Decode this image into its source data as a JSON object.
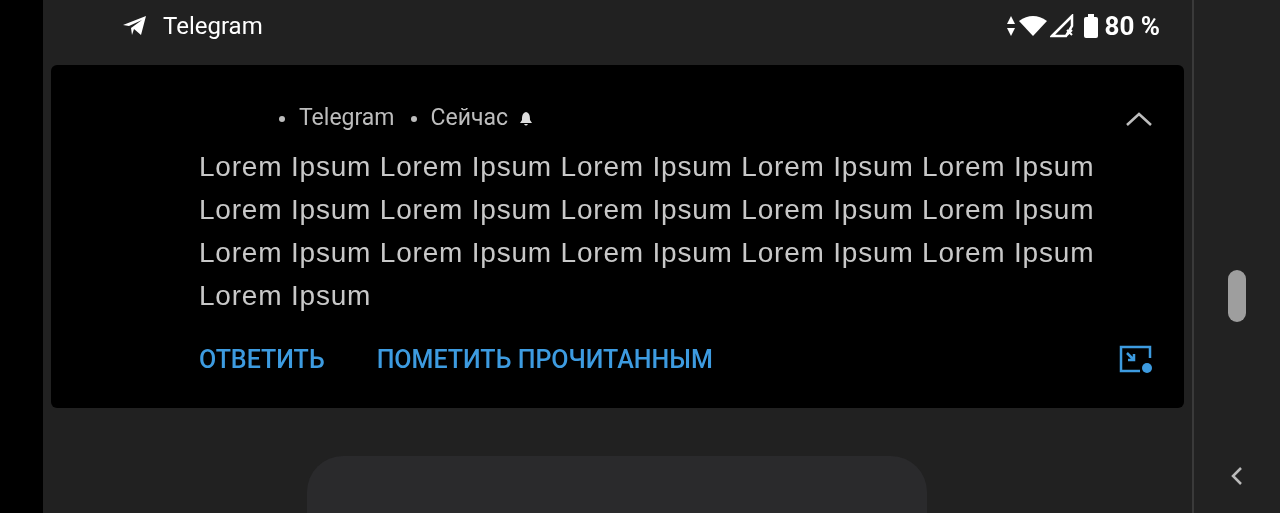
{
  "status_bar": {
    "app_name": "Telegram",
    "battery": "80 %"
  },
  "notification": {
    "app": "Telegram",
    "time": "Сейчас",
    "expanded": true,
    "message": "Lorem Ipsum Lorem Ipsum Lorem Ipsum Lorem Ipsum Lorem Ipsum Lorem Ipsum Lorem Ipsum Lorem Ipsum Lorem Ipsum Lorem Ipsum Lorem Ipsum Lorem Ipsum Lorem Ipsum Lorem Ipsum Lorem Ipsum Lorem Ipsum",
    "actions": [
      "ОТВЕТИТЬ",
      "ПОМЕТИТЬ ПРОЧИТАННЫМ"
    ]
  }
}
